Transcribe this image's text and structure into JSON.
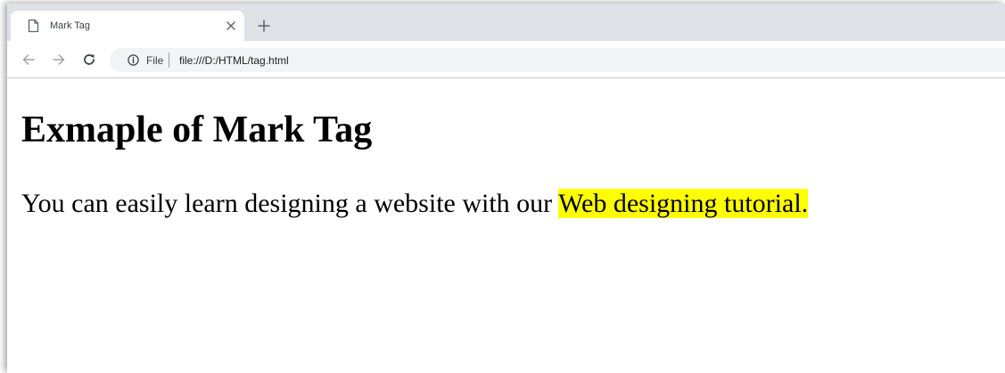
{
  "tab": {
    "title": "Mark Tag",
    "favicon": "page-icon"
  },
  "toolbar": {
    "back_icon": "back-arrow-icon",
    "forward_icon": "forward-arrow-icon",
    "reload_icon": "reload-icon"
  },
  "omnibox": {
    "info_icon": "info-icon",
    "scheme_label": "File",
    "url": "file:///D:/HTML/tag.html"
  },
  "page": {
    "heading": "Exmaple of Mark Tag",
    "paragraph_text": "You can easily learn designing a website with our ",
    "highlighted_text": "Web designing tutorial.",
    "highlight_color": "#ffff00"
  },
  "colors": {
    "tabstrip": "#dee1e6",
    "omnibox": "#f1f3f4"
  }
}
